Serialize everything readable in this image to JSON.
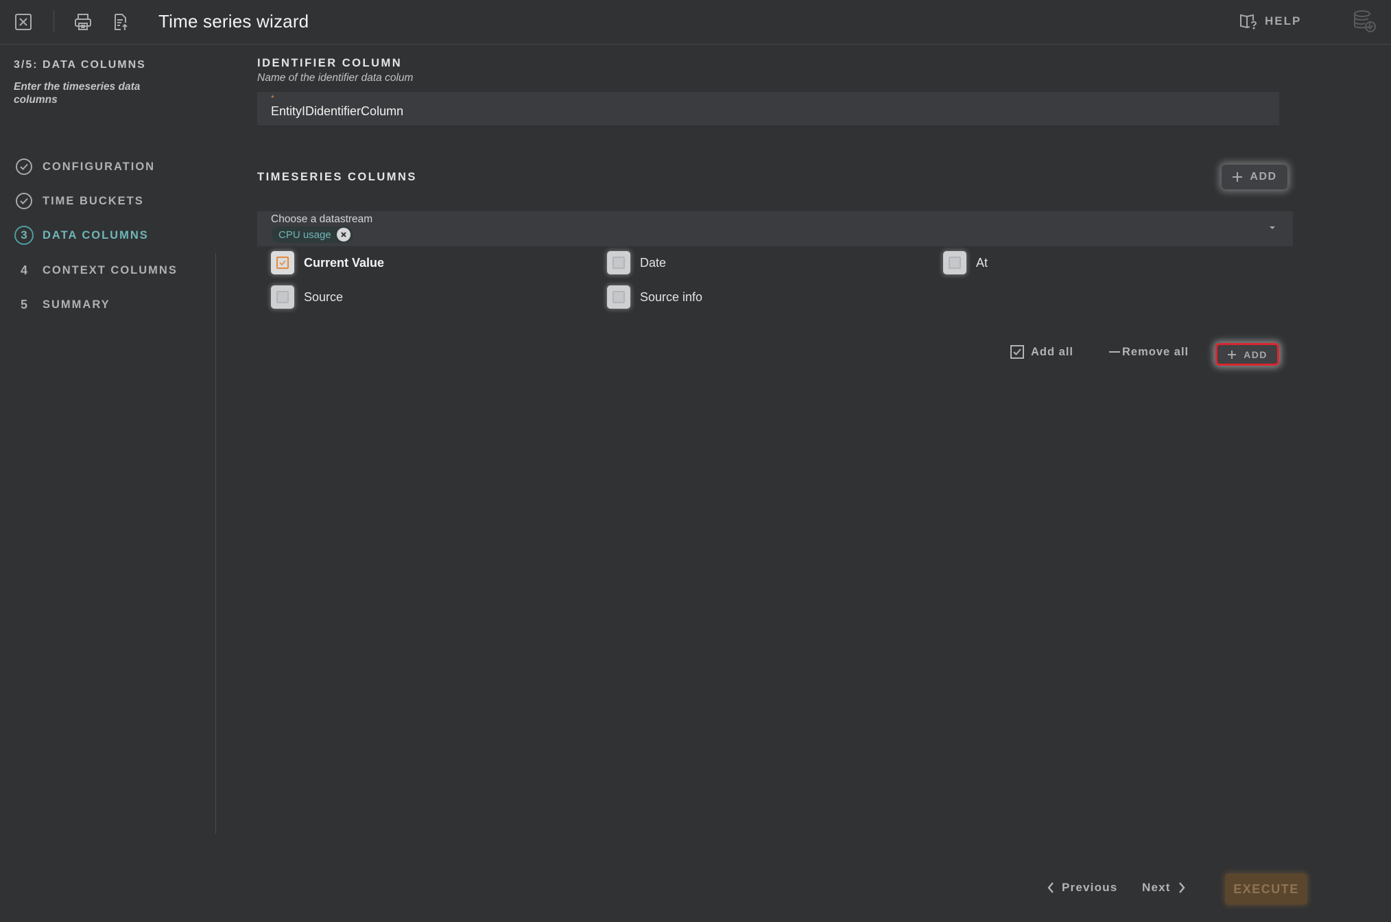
{
  "header": {
    "title": "Time series wizard",
    "help_label": "HELP"
  },
  "sidebar": {
    "step_heading": "3/5: DATA COLUMNS",
    "step_description": "Enter the timeseries data columns",
    "items": [
      {
        "marker": "check",
        "label": "CONFIGURATION"
      },
      {
        "marker": "check",
        "label": "TIME BUCKETS"
      },
      {
        "marker": "3",
        "label": "DATA COLUMNS"
      },
      {
        "marker": "4",
        "label": "CONTEXT COLUMNS"
      },
      {
        "marker": "5",
        "label": "SUMMARY"
      }
    ]
  },
  "identifier": {
    "title": "IDENTIFIER COLUMN",
    "subtitle": "Name of the identifier data colum",
    "required_mark": "*",
    "value": "EntityIDidentifierColumn"
  },
  "timeseries": {
    "title": "TIMESERIES COLUMNS",
    "add_label": "ADD",
    "select_label": "Choose a datastream",
    "chip": "CPU usage",
    "columns": [
      {
        "label": "Current Value",
        "checked": true
      },
      {
        "label": "Date",
        "checked": false
      },
      {
        "label": "At",
        "checked": false
      },
      {
        "label": "Source",
        "checked": false
      },
      {
        "label": "Source info",
        "checked": false
      }
    ],
    "add_all": "Add all",
    "remove_all": "Remove all",
    "add_bottom": "ADD"
  },
  "footer": {
    "previous": "Previous",
    "next": "Next",
    "execute": "EXECUTE"
  },
  "colors": {
    "background": "#313234",
    "accent_teal": "#6fb6b8",
    "accent_orange": "#e08a3c",
    "highlight_red": "#d9262e"
  }
}
